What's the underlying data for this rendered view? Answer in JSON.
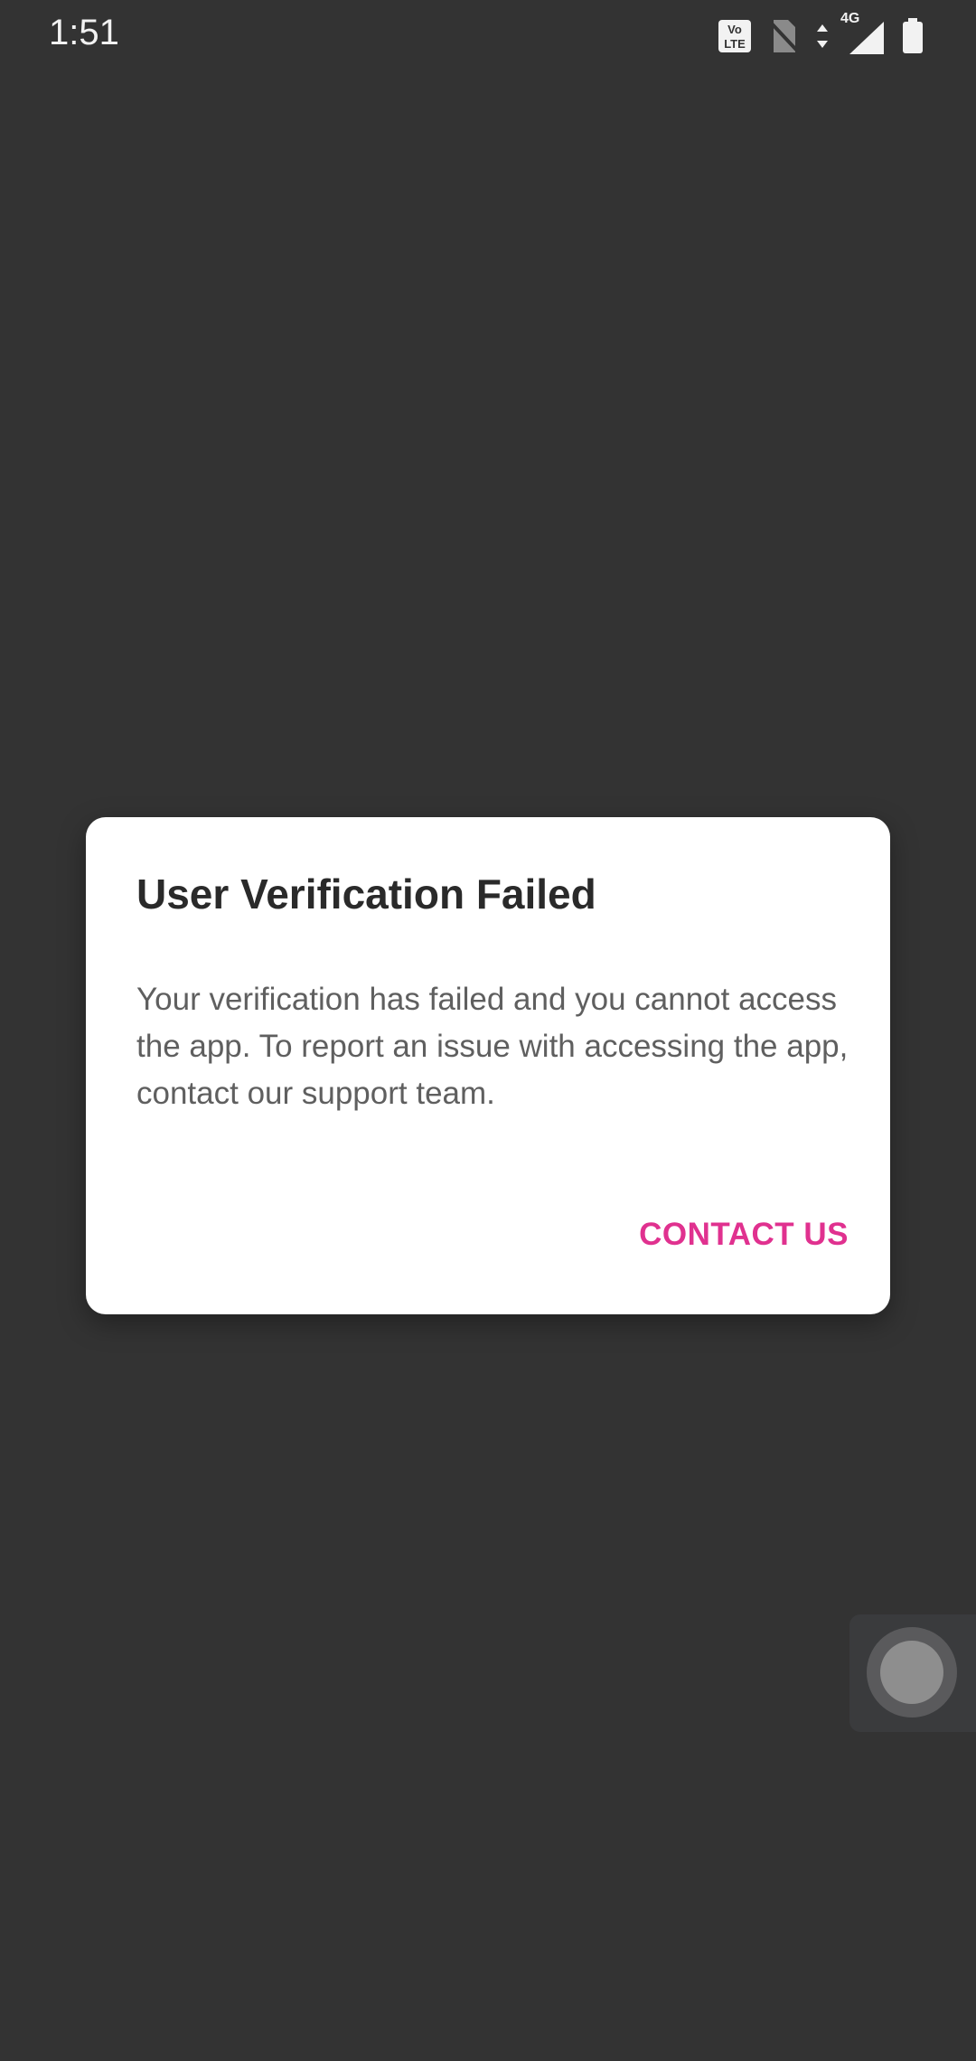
{
  "status_bar": {
    "time": "1:51",
    "icons": [
      "volte-icon",
      "no-sim-icon",
      "data-arrows-icon",
      "signal-4g-icon",
      "battery-icon"
    ],
    "network_label": "4G",
    "volte_label_top": "Vo",
    "volte_label_bottom": "LTE"
  },
  "dialog": {
    "title": "User Verification Failed",
    "message": "Your verification has failed and you cannot access the app. To report an issue with accessing the app, contact our support team.",
    "action_label": "CONTACT US",
    "accent_color": "#e0318f"
  },
  "colors": {
    "background": "#333333",
    "dialog_background": "#ffffff"
  }
}
